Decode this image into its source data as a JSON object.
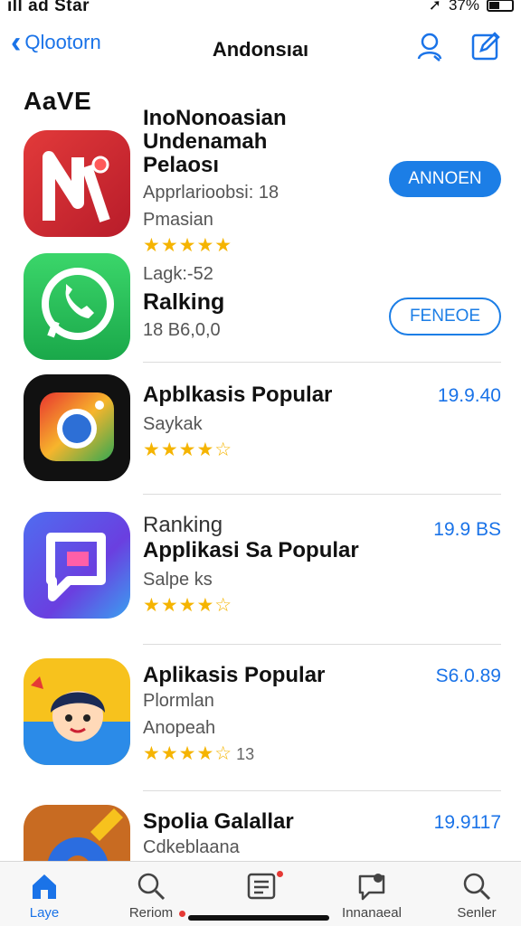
{
  "status": {
    "carrier": "ıll ad Star",
    "battery": "37%"
  },
  "nav": {
    "back_label": "Qlootorn",
    "title": "Andonsıaı"
  },
  "section_title": "AaVE",
  "apps": [
    {
      "title_lines": [
        "InoNonoasian",
        "Undenamah",
        "Pelaosı"
      ],
      "subtitle": "Apprlarioobsi: 18",
      "subtitle2": "Pmasian",
      "stars": "★★★★★",
      "rating_count": "",
      "action": "ANNOEN",
      "price": ""
    },
    {
      "title_lines": [
        "Lagk:-52"
      ],
      "subtitle": "",
      "title2": "Ralking",
      "subtitle2": "18 B6,0,0",
      "stars": "",
      "rating_count": "",
      "action": "FENEOE",
      "price": ""
    },
    {
      "title_lines": [
        "Apblkasis Popular"
      ],
      "subtitle": "Saykak",
      "stars": "★★★★☆",
      "rating_count": "",
      "price": "19.9.40"
    },
    {
      "title_lines": [
        "Ranking",
        "Applikasi Sa Popular"
      ],
      "subtitle": "Salpe ks",
      "stars": "★★★★☆",
      "rating_count": "",
      "price": "19.9 BS"
    },
    {
      "title_lines": [
        "Aplikasis Popular"
      ],
      "subtitle": "Plormlan",
      "subtitle2": "Anopeah",
      "stars": "★★★★☆",
      "rating_count": "13",
      "price": "S6.0.89"
    },
    {
      "title_lines": [
        "Spolia Galallar"
      ],
      "subtitle": "Cdkeblaana",
      "stars": "",
      "rating_count": "",
      "price": "19.9117"
    }
  ],
  "tabs": [
    {
      "label": "Laye",
      "icon": "home-icon"
    },
    {
      "label": "Reriom",
      "icon": "search-icon"
    },
    {
      "label": "",
      "icon": "list-icon"
    },
    {
      "label": "Innanaeal",
      "icon": "chat-icon"
    },
    {
      "label": "Senler",
      "icon": "search-icon"
    }
  ],
  "colors": {
    "accent": "#1a73e8",
    "star": "#f5b400",
    "button": "#1c7ee6"
  }
}
